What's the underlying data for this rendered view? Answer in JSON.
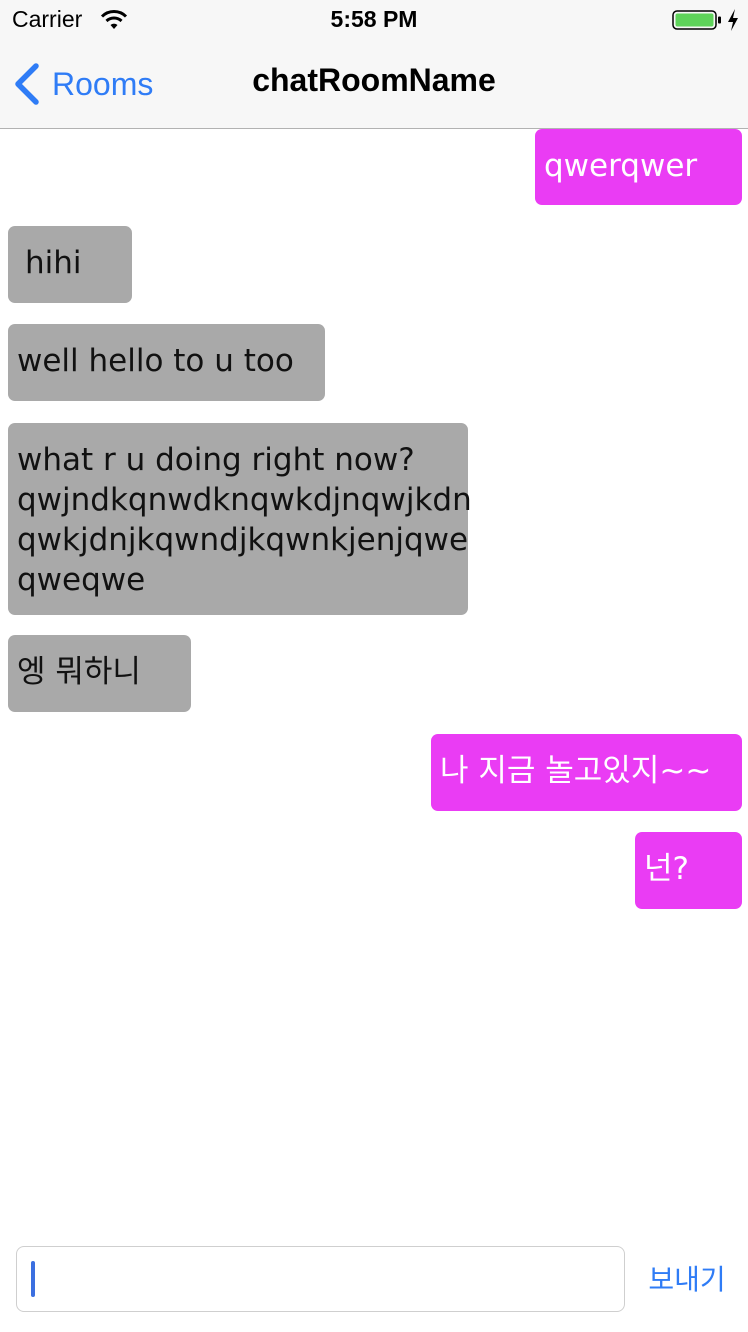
{
  "status_bar": {
    "carrier": "Carrier",
    "time": "5:58 PM",
    "icons": [
      "wifi-icon",
      "battery-icon",
      "charging-icon"
    ]
  },
  "nav": {
    "back_label": "Rooms",
    "title": "chatRoomName"
  },
  "messages": [
    {
      "text": "qwerqwer",
      "direction": "out"
    },
    {
      "text": "hihi",
      "direction": "in"
    },
    {
      "text": "well hello to u too",
      "direction": "in"
    },
    {
      "text": "what r u doing right now?\nqwjndkqnwdknqwkdjnqwjkdn\nqwkjdnjkqwndjkqwnkjenjqwe\nqweqwe",
      "direction": "in"
    },
    {
      "text": "엥 뭐하니",
      "direction": "in"
    },
    {
      "text": "나 지금 놀고있지~~",
      "direction": "out"
    },
    {
      "text": "넌?",
      "direction": "out"
    }
  ],
  "composer": {
    "input_value": "",
    "send_label": "보내기"
  },
  "colors": {
    "incoming_bubble": "#a9a9a9",
    "outgoing_bubble": "#ea3cf4",
    "accent": "#2f7cf6"
  }
}
